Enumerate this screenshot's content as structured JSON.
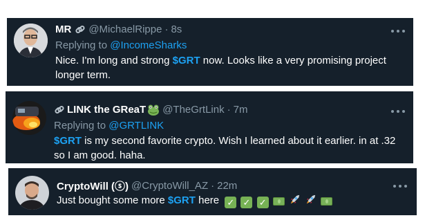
{
  "tweets": [
    {
      "name": "MR",
      "name_icon": "link-icon",
      "handle": "@MichaelRippe",
      "time": "8s",
      "reply_prefix": "Replying to",
      "reply_to": "@IncomeSharks",
      "text_before": "Nice. I'm long and strong ",
      "cashtag": "$GRT",
      "text_after": " now. Looks like a very promising project longer term."
    },
    {
      "name": "LINK the GReaT",
      "name_prefix_icon": "link-icon",
      "name_suffix_icon": "frog-emoji-icon",
      "handle": "@TheGrtLink",
      "time": "7m",
      "reply_prefix": "Replying to",
      "reply_to": "@GRTLINK",
      "cashtag": "$GRT",
      "text_after": " is my second favorite crypto. Wish I learned about it earlier. in at .32 so I am good. haha."
    },
    {
      "name": "CryptoWill (ⓢ)",
      "handle": "@CryptoWill_AZ",
      "time": "22m",
      "text_before": "Just bought some more ",
      "cashtag": "$GRT",
      "text_after": " here",
      "emojis": [
        "check-icon",
        "check-icon",
        "check-icon",
        "money-icon",
        "rocket-icon",
        "rocket-icon",
        "money-icon"
      ]
    }
  ],
  "colors": {
    "card_bg": "#15202b",
    "muted": "#8899a6",
    "accent": "#1da1f2"
  }
}
